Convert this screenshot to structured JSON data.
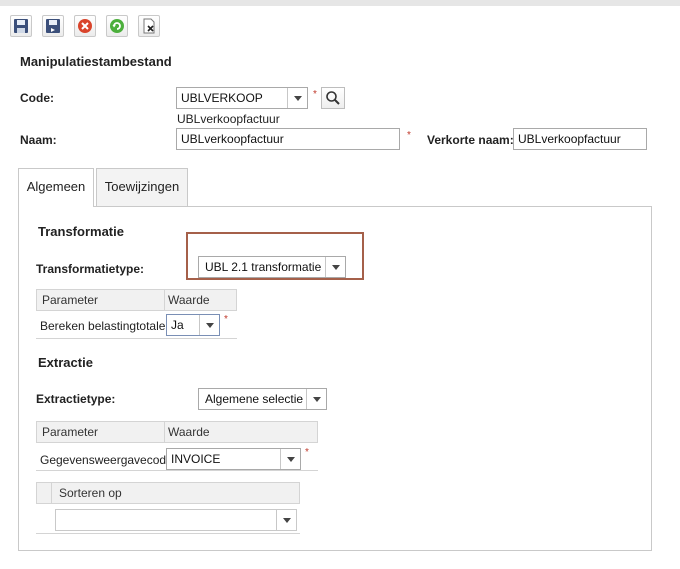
{
  "toolbar": {
    "buttons": [
      {
        "name": "save",
        "icon": "floppy-disk-icon"
      },
      {
        "name": "save-close",
        "icon": "floppy-disk-arrow-icon"
      },
      {
        "name": "cancel",
        "icon": "red-cancel-icon"
      },
      {
        "name": "refresh",
        "icon": "green-refresh-icon"
      },
      {
        "name": "delete",
        "icon": "document-delete-icon"
      }
    ]
  },
  "page": {
    "title": "Manipulatiestambestand"
  },
  "form": {
    "code_label": "Code:",
    "code_value": "UBLVERKOOP",
    "code_description": "UBLverkoopfactuur",
    "required_mark": "*",
    "naam_label": "Naam:",
    "naam_value": "UBLverkoopfactuur",
    "short_name_label": "Verkorte naam:",
    "short_name_value": "UBLverkoopfactuur"
  },
  "tabs": [
    {
      "label": "Algemeen",
      "active": true
    },
    {
      "label": "Toewijzingen",
      "active": false
    }
  ],
  "transformatie": {
    "heading": "Transformatie",
    "type_label": "Transformatietype:",
    "type_value": "UBL 2.1 transformatie",
    "grid": {
      "col_parameter": "Parameter",
      "col_waarde": "Waarde",
      "rows": [
        {
          "parameter": "Bereken belastingtotalen",
          "waarde": "Ja"
        }
      ]
    }
  },
  "extractie": {
    "heading": "Extractie",
    "type_label": "Extractietype:",
    "type_value": "Algemene selectie",
    "grid": {
      "col_parameter": "Parameter",
      "col_waarde": "Waarde",
      "rows": [
        {
          "parameter": "Gegevensweergavecode",
          "waarde": "INVOICE"
        }
      ]
    },
    "sort_header": "Sorteren op",
    "sort_value": ""
  },
  "colors": {
    "highlight_border": "#a5604a",
    "required": "#c0392b"
  }
}
